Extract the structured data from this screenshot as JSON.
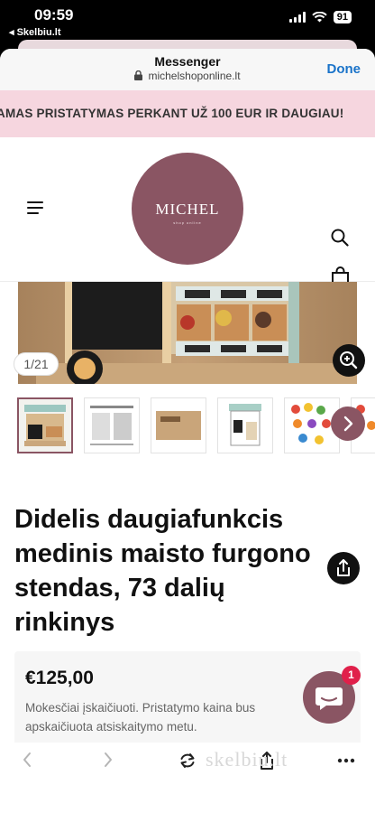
{
  "status_bar": {
    "time": "09:59",
    "back_app": "◂ Skelbiu.lt",
    "battery": "91"
  },
  "messenger": {
    "title": "Messenger",
    "url": "michelshoponline.lt",
    "done": "Done"
  },
  "promo": {
    "text": "AMAS PRISTATYMAS PERKANT UŽ 100 EUR IR DAUGIAU!"
  },
  "logo": {
    "text": "MICHEL",
    "subtitle": "shop online"
  },
  "header_icons": [
    "menu-icon",
    "search-icon",
    "shopping-bag-icon"
  ],
  "gallery": {
    "counter": "1/21",
    "thumbnail_count": 6
  },
  "product": {
    "title": "Didelis daugiafunkcis medinis maisto furgono stendas, 73 dalių rinkinys",
    "price": "€125,00",
    "tax_note": "Mokesčiai įskaičiuoti. Pristatymo kaina bus apskaičiuota atsiskaitymo metu."
  },
  "chat": {
    "badge": "1"
  },
  "toolbar_icons": [
    "back-icon",
    "forward-icon",
    "reload-icon",
    "share-icon",
    "more-icon"
  ],
  "watermark": "skelbiu.lt",
  "colors": {
    "brand": "#8a5563",
    "promo_bg": "#f6d6df",
    "link": "#1a73c9",
    "badge": "#e0204a"
  }
}
